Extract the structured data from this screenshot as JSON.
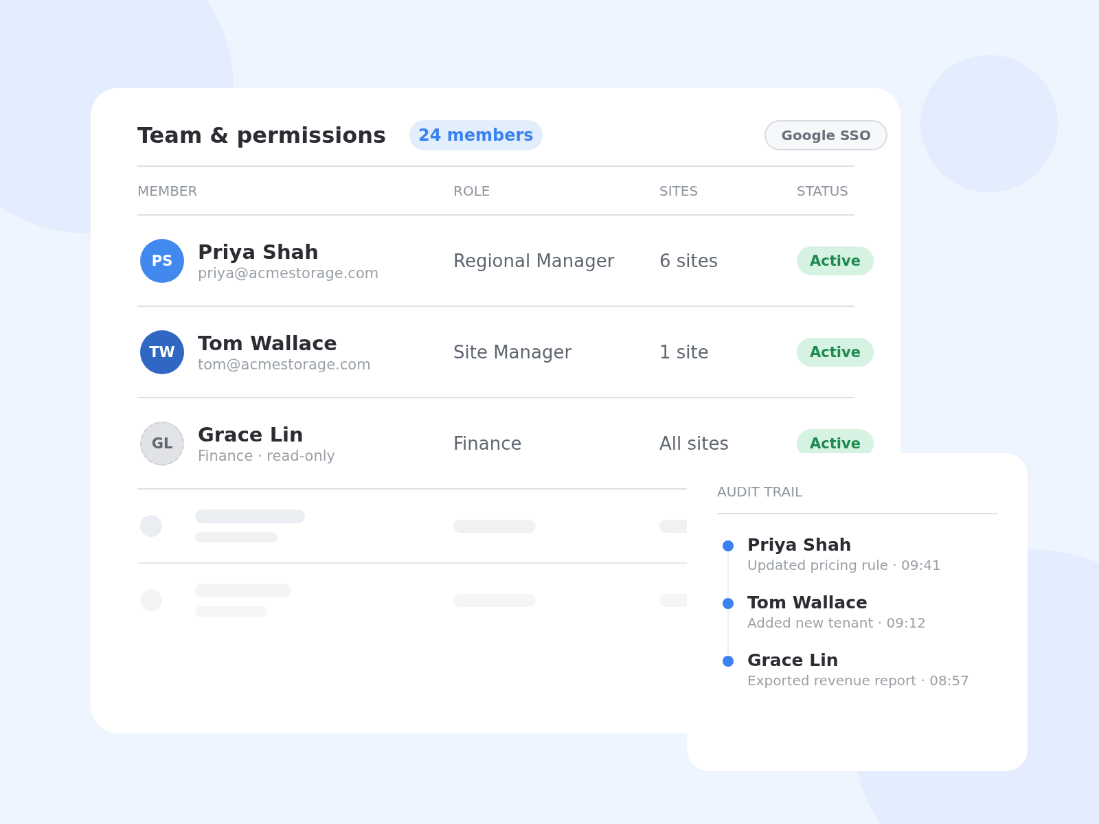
{
  "card": {
    "title": "Team & permissions",
    "member_count": "24 members",
    "sso_badge": "Google SSO"
  },
  "table": {
    "columns": [
      "MEMBER",
      "ROLE",
      "SITES",
      "STATUS"
    ],
    "rows": [
      {
        "initials": "PS",
        "color": "#4189ee",
        "pending": false,
        "name": "Priya Shah",
        "detail": "priya@acmestorage.com",
        "role": "Regional Manager",
        "sites": "6 sites",
        "status": "Active",
        "kind": "active"
      },
      {
        "initials": "TW",
        "color": "#2f67c2",
        "pending": false,
        "name": "Tom Wallace",
        "detail": "tom@acmestorage.com",
        "role": "Site Manager",
        "sites": "1 site",
        "status": "Active",
        "kind": "active"
      },
      {
        "initials": "GL",
        "color": "#e2e3e6",
        "pending": true,
        "name": "Grace Lin",
        "detail": "Finance · read-only",
        "role": "Finance",
        "sites": "All sites",
        "status": "Active",
        "kind": "active"
      }
    ],
    "placeholder_rows": [
      {
        "kind": "loading"
      },
      {
        "kind": "loading"
      }
    ]
  },
  "audit_trail": {
    "title": "AUDIT TRAIL",
    "entries": [
      {
        "name": "Priya Shah",
        "detail": "Updated pricing rule · 09:41"
      },
      {
        "name": "Tom Wallace",
        "detail": "Added new tenant · 09:12"
      },
      {
        "name": "Grace Lin",
        "detail": "Exported revenue report · 08:57"
      }
    ]
  }
}
